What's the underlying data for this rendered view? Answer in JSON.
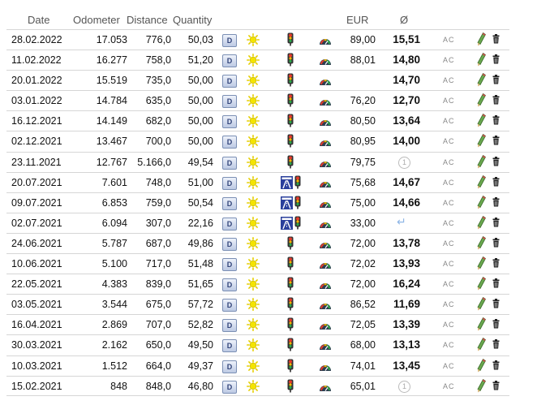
{
  "headers": {
    "date": "Date",
    "odometer": "Odometer",
    "distance": "Distance",
    "quantity": "Quantity",
    "eur": "EUR",
    "avg": "Ø"
  },
  "fuel_badge": "D",
  "ac_label": "AC",
  "circle_label": "1",
  "return_glyph": "↵",
  "colors": {
    "highway": "#2a3f9b",
    "sun": "#f4e400",
    "pencil": "#6aa84f",
    "trash": "#222"
  },
  "icons": [
    "fuel-type-icon",
    "sunny-weather-icon",
    "highway-icon",
    "traffic-light-icon",
    "speedometer-icon",
    "pencil-edit-icon",
    "trash-delete-icon"
  ],
  "rows": [
    {
      "date": "28.02.2022",
      "odometer": "17.053",
      "distance": "776,0",
      "quantity": "50,03",
      "highway": false,
      "eur": "89,00",
      "consumption": "15,51",
      "marker": ""
    },
    {
      "date": "11.02.2022",
      "odometer": "16.277",
      "distance": "758,0",
      "quantity": "51,20",
      "highway": false,
      "eur": "88,01",
      "consumption": "14,80",
      "marker": ""
    },
    {
      "date": "20.01.2022",
      "odometer": "15.519",
      "distance": "735,0",
      "quantity": "50,00",
      "highway": false,
      "eur": "",
      "consumption": "14,70",
      "marker": ""
    },
    {
      "date": "03.01.2022",
      "odometer": "14.784",
      "distance": "635,0",
      "quantity": "50,00",
      "highway": false,
      "eur": "76,20",
      "consumption": "12,70",
      "marker": ""
    },
    {
      "date": "16.12.2021",
      "odometer": "14.149",
      "distance": "682,0",
      "quantity": "50,00",
      "highway": false,
      "eur": "80,50",
      "consumption": "13,64",
      "marker": ""
    },
    {
      "date": "02.12.2021",
      "odometer": "13.467",
      "distance": "700,0",
      "quantity": "50,00",
      "highway": false,
      "eur": "80,95",
      "consumption": "14,00",
      "marker": ""
    },
    {
      "date": "23.11.2021",
      "odometer": "12.767",
      "distance": "5.166,0",
      "quantity": "49,54",
      "highway": false,
      "eur": "79,75",
      "consumption": "",
      "marker": "circle"
    },
    {
      "date": "20.07.2021",
      "odometer": "7.601",
      "distance": "748,0",
      "quantity": "51,00",
      "highway": true,
      "eur": "75,68",
      "consumption": "14,67",
      "marker": ""
    },
    {
      "date": "09.07.2021",
      "odometer": "6.853",
      "distance": "759,0",
      "quantity": "50,54",
      "highway": true,
      "eur": "75,00",
      "consumption": "14,66",
      "marker": ""
    },
    {
      "date": "02.07.2021",
      "odometer": "6.094",
      "distance": "307,0",
      "quantity": "22,16",
      "highway": true,
      "eur": "33,00",
      "consumption": "",
      "marker": "return"
    },
    {
      "date": "24.06.2021",
      "odometer": "5.787",
      "distance": "687,0",
      "quantity": "49,86",
      "highway": false,
      "eur": "72,00",
      "consumption": "13,78",
      "marker": ""
    },
    {
      "date": "10.06.2021",
      "odometer": "5.100",
      "distance": "717,0",
      "quantity": "51,48",
      "highway": false,
      "eur": "72,02",
      "consumption": "13,93",
      "marker": ""
    },
    {
      "date": "22.05.2021",
      "odometer": "4.383",
      "distance": "839,0",
      "quantity": "51,65",
      "highway": false,
      "eur": "72,00",
      "consumption": "16,24",
      "marker": ""
    },
    {
      "date": "03.05.2021",
      "odometer": "3.544",
      "distance": "675,0",
      "quantity": "57,72",
      "highway": false,
      "eur": "86,52",
      "consumption": "11,69",
      "marker": ""
    },
    {
      "date": "16.04.2021",
      "odometer": "2.869",
      "distance": "707,0",
      "quantity": "52,82",
      "highway": false,
      "eur": "72,05",
      "consumption": "13,39",
      "marker": ""
    },
    {
      "date": "30.03.2021",
      "odometer": "2.162",
      "distance": "650,0",
      "quantity": "49,50",
      "highway": false,
      "eur": "68,00",
      "consumption": "13,13",
      "marker": ""
    },
    {
      "date": "10.03.2021",
      "odometer": "1.512",
      "distance": "664,0",
      "quantity": "49,37",
      "highway": false,
      "eur": "74,01",
      "consumption": "13,45",
      "marker": ""
    },
    {
      "date": "15.02.2021",
      "odometer": "848",
      "distance": "848,0",
      "quantity": "46,80",
      "highway": false,
      "eur": "65,01",
      "consumption": "",
      "marker": "circle"
    }
  ]
}
